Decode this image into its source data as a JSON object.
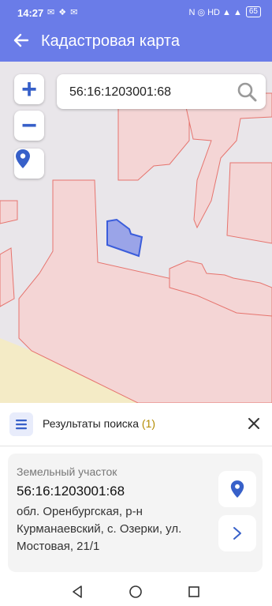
{
  "status_bar": {
    "time": "14:27",
    "left_icons": "✉ ❖ ✉",
    "right_icons": "N ◎ HD ▲ ▲",
    "battery": "65"
  },
  "app_bar": {
    "title": "Кадастровая карта",
    "back_icon": "arrow-left-icon"
  },
  "map": {
    "zoom_in": "+",
    "zoom_out": "−",
    "search": {
      "value": "56:16:1203001:68",
      "placeholder": ""
    },
    "colors": {
      "background": "#e9e6ea",
      "parcel_fill": "#f4d5d5",
      "parcel_stroke": "#e6746e",
      "selected_fill": "#9aa4e8",
      "selected_stroke": "#3b5ddb",
      "field": "#f4ebc6"
    }
  },
  "results": {
    "title": "Результаты поиска",
    "count": "(1)",
    "item": {
      "type": "Земельный участок",
      "number": "56:16:1203001:68",
      "address": "обл. Оренбургская, р-н Курманаевский, с. Озерки, ул. Мостовая, 21/1"
    }
  },
  "nav_bar": {
    "back": "◁",
    "home": "○",
    "recents": "□"
  }
}
